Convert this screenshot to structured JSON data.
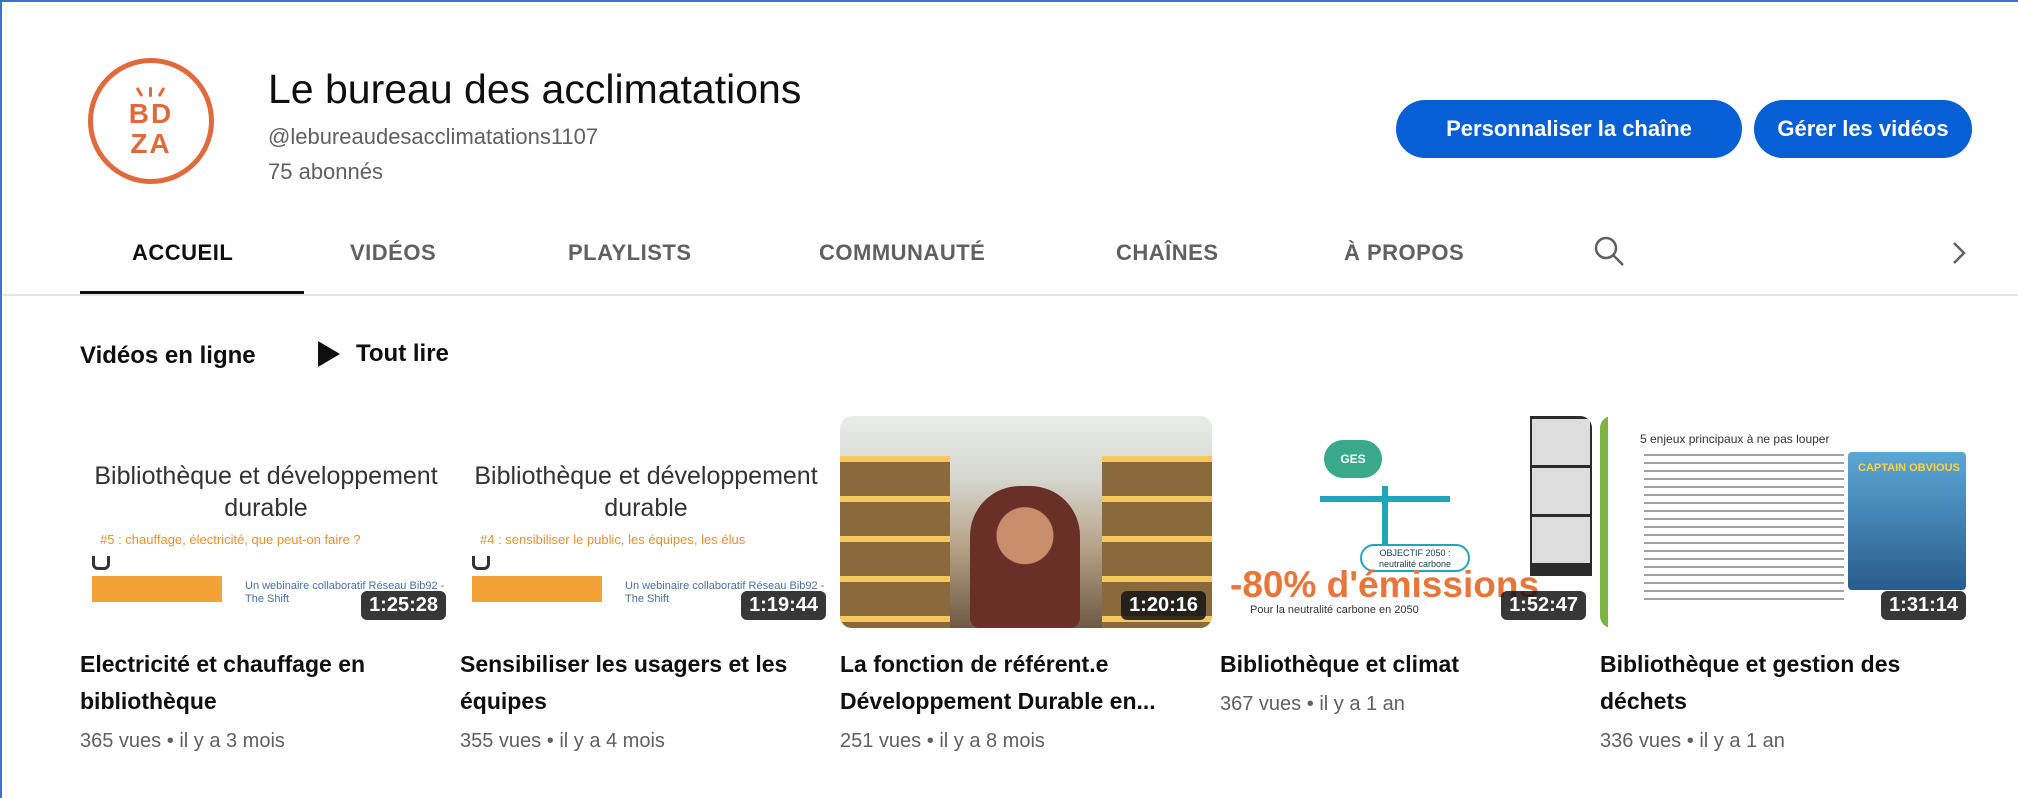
{
  "channel": {
    "avatar_lines": [
      "BD",
      "ZA"
    ],
    "title": "Le bureau des acclimatations",
    "handle": "@lebureaudesacclimatations1107",
    "subscribers": "75 abonnés",
    "accent_color": "#e06a3c"
  },
  "actions": {
    "customize": "Personnaliser la chaîne",
    "manage": "Gérer les vidéos",
    "button_color": "#065fd4"
  },
  "tabs": [
    {
      "label": "ACCUEIL",
      "active": true
    },
    {
      "label": "VIDÉOS",
      "active": false
    },
    {
      "label": "PLAYLISTS",
      "active": false
    },
    {
      "label": "COMMUNAUTÉ",
      "active": false
    },
    {
      "label": "CHAÎNES",
      "active": false
    },
    {
      "label": "À PROPOS",
      "active": false
    }
  ],
  "icons": {
    "search": "search-icon",
    "next": "chevron-right-icon",
    "play": "play-icon"
  },
  "section": {
    "title": "Vidéos en ligne",
    "play_all": "Tout lire"
  },
  "videos": [
    {
      "title": "Electricité et chauffage en bibliothèque",
      "views": "365 vues",
      "age": "il y a 3 mois",
      "duration": "1:25:28",
      "thumb_title": "Bibliothèque et développement durable",
      "thumb_sub": "#5 : chauffage, électricité, que peut-on faire ?",
      "thumb_footer": "Un webinaire collaboratif Réseau Bib92 - The Shift"
    },
    {
      "title": "Sensibiliser les usagers et les équipes",
      "views": "355 vues",
      "age": "il y a 4 mois",
      "duration": "1:19:44",
      "thumb_title": "Bibliothèque et développement durable",
      "thumb_sub": "#4 : sensibiliser le public, les équipes, les élus",
      "thumb_footer": "Un webinaire collaboratif Réseau Bib92 - The Shift"
    },
    {
      "title": "La fonction de référent.e Développement Durable en...",
      "views": "251 vues",
      "age": "il y a 8 mois",
      "duration": "1:20:16"
    },
    {
      "title": "Bibliothèque et climat",
      "views": "367 vues",
      "age": "il y a 1 an",
      "duration": "1:52:47",
      "thumb_cloud": "GES",
      "thumb_objective": "OBJECTIF 2050 : neutralité carbone",
      "thumb_big": "-80% d'émissions",
      "thumb_sub": "Pour la neutralité carbone en 2050"
    },
    {
      "title": "Bibliothèque et gestion des déchets",
      "views": "336 vues",
      "age": "il y a 1 an",
      "duration": "1:31:14",
      "thumb_head": "5 enjeux principaux à ne pas louper",
      "thumb_comic": "CAPTAIN OBVIOUS"
    }
  ],
  "meta_separator": "•"
}
